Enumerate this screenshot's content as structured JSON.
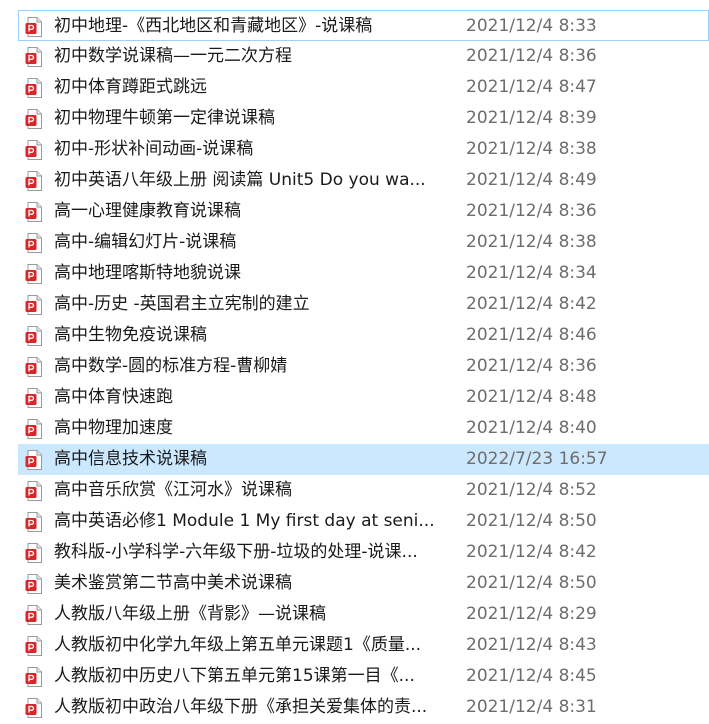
{
  "files": [
    {
      "name": "初中地理-《西北地区和青藏地区》-说课稿",
      "date": "2021/12/4 8:33",
      "icon": "pdf-icon"
    },
    {
      "name": "初中数学说课稿—一元二次方程",
      "date": "2021/12/4 8:36",
      "icon": "pdf-icon"
    },
    {
      "name": "初中体育蹲距式跳远",
      "date": "2021/12/4 8:47",
      "icon": "pdf-icon"
    },
    {
      "name": "初中物理牛顿第一定律说课稿",
      "date": "2021/12/4 8:39",
      "icon": "pdf-icon"
    },
    {
      "name": "初中-形状补间动画-说课稿",
      "date": "2021/12/4 8:38",
      "icon": "pdf-icon"
    },
    {
      "name": "初中英语八年级上册 阅读篇  Unit5 Do you wa...",
      "date": "2021/12/4 8:49",
      "icon": "pdf-icon"
    },
    {
      "name": "高一心理健康教育说课稿",
      "date": "2021/12/4 8:36",
      "icon": "pdf-icon"
    },
    {
      "name": "高中-编辑幻灯片-说课稿",
      "date": "2021/12/4 8:38",
      "icon": "pdf-icon"
    },
    {
      "name": "高中地理喀斯特地貌说课",
      "date": "2021/12/4 8:34",
      "icon": "pdf-icon"
    },
    {
      "name": "高中-历史 -英国君主立宪制的建立",
      "date": "2021/12/4 8:42",
      "icon": "pdf-icon"
    },
    {
      "name": "高中生物免疫说课稿",
      "date": "2021/12/4 8:46",
      "icon": "pdf-icon"
    },
    {
      "name": "高中数学-圆的标准方程-曹柳婧",
      "date": "2021/12/4 8:36",
      "icon": "pdf-icon"
    },
    {
      "name": "高中体育快速跑",
      "date": "2021/12/4 8:48",
      "icon": "pdf-icon"
    },
    {
      "name": "高中物理加速度",
      "date": "2021/12/4 8:40",
      "icon": "pdf-icon"
    },
    {
      "name": "高中信息技术说课稿",
      "date": "2022/7/23 16:57",
      "icon": "pdf-icon"
    },
    {
      "name": "高中音乐欣赏《江河水》说课稿",
      "date": "2021/12/4 8:52",
      "icon": "pdf-icon"
    },
    {
      "name": "高中英语必修1 Module 1 My first day at seni...",
      "date": "2021/12/4 8:50",
      "icon": "pdf-icon"
    },
    {
      "name": "教科版-小学科学-六年级下册-垃圾的处理-说课...",
      "date": "2021/12/4 8:42",
      "icon": "pdf-icon"
    },
    {
      "name": "美术鉴赏第二节高中美术说课稿",
      "date": "2021/12/4 8:50",
      "icon": "pdf-icon"
    },
    {
      "name": "人教版八年级上册《背影》—说课稿",
      "date": "2021/12/4 8:29",
      "icon": "pdf-icon"
    },
    {
      "name": "人教版初中化学九年级上第五单元课题1《质量...",
      "date": "2021/12/4 8:43",
      "icon": "pdf-icon"
    },
    {
      "name": "人教版初中历史八下第五单元第15课第一目《...",
      "date": "2021/12/4 8:45",
      "icon": "pdf-icon"
    },
    {
      "name": "人教版初中政治八年级下册《承担关爱集体的责...",
      "date": "2021/12/4 8:31",
      "icon": "pdf-icon"
    }
  ],
  "focused_index": 0,
  "selected_index": 14,
  "colors": {
    "selection": "#cce8ff",
    "focus_border": "#99d1ff",
    "pdf_red": "#d9262b"
  }
}
